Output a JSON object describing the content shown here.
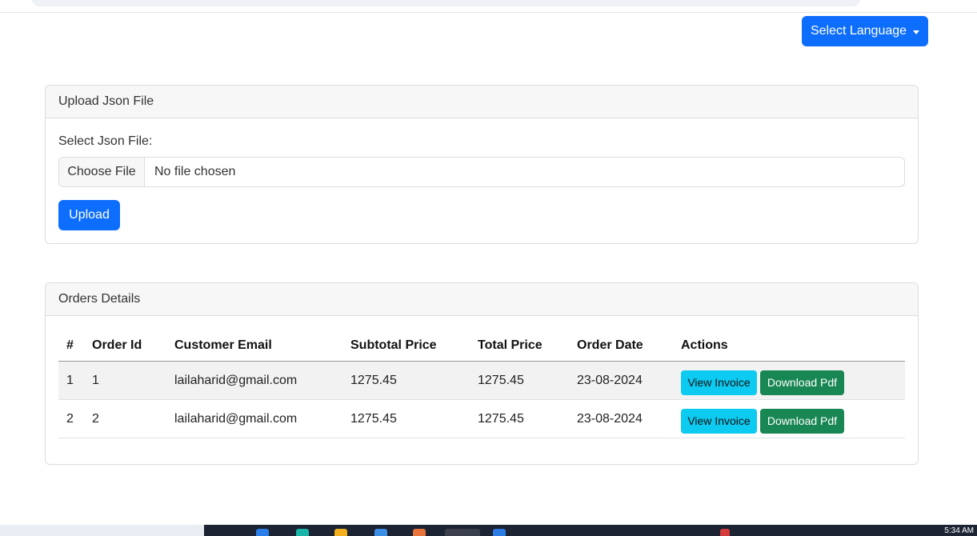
{
  "header": {
    "language_button": "Select Language"
  },
  "upload_card": {
    "title": "Upload Json File",
    "field_label": "Select Json File:",
    "choose_button": "Choose File",
    "file_status": "No file chosen",
    "upload_button": "Upload"
  },
  "orders_card": {
    "title": "Orders Details",
    "columns": [
      "#",
      "Order Id",
      "Customer Email",
      "Subtotal Price",
      "Total Price",
      "Order Date",
      "Actions"
    ],
    "rows": [
      {
        "num": "1",
        "order_id": "1",
        "email": "lailaharid@gmail.com",
        "subtotal": "1275.45",
        "total": "1275.45",
        "date": "23-08-2024",
        "view": "View Invoice",
        "download": "Download Pdf"
      },
      {
        "num": "2",
        "order_id": "2",
        "email": "lailaharid@gmail.com",
        "subtotal": "1275.45",
        "total": "1275.45",
        "date": "23-08-2024",
        "view": "View Invoice",
        "download": "Download Pdf"
      }
    ]
  },
  "taskbar": {
    "clock": "5:34 AM"
  },
  "colors": {
    "primary": "#0d6efd",
    "info": "#0dcaf0",
    "success": "#198754"
  }
}
